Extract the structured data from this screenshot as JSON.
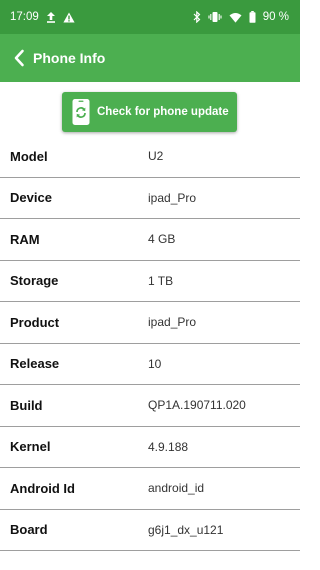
{
  "status_bar": {
    "time": "17:09",
    "battery": "90 %",
    "icons_left": [
      "upload-icon",
      "warning-icon"
    ],
    "icons_right": [
      "bluetooth-icon",
      "vibrate-icon",
      "wifi-icon",
      "battery-icon"
    ]
  },
  "app_bar": {
    "title": "Phone Info",
    "back_icon": "chevron-left-icon"
  },
  "update_button": {
    "label": "Check for phone update",
    "icon": "phone-update-icon"
  },
  "info": [
    {
      "label": "Model",
      "value": "U2"
    },
    {
      "label": "Device",
      "value": "ipad_Pro"
    },
    {
      "label": "RAM",
      "value": "4 GB"
    },
    {
      "label": "Storage",
      "value": "1 TB"
    },
    {
      "label": "Product",
      "value": "ipad_Pro"
    },
    {
      "label": "Release",
      "value": "10"
    },
    {
      "label": "Build",
      "value": "QP1A.190711.020"
    },
    {
      "label": "Kernel",
      "value": "4.9.188"
    },
    {
      "label": "Android Id",
      "value": "android_id"
    },
    {
      "label": "Board",
      "value": "g6j1_dx_u121"
    }
  ],
  "colors": {
    "status_bar": "#3a9a3e",
    "app_bar": "#4caf50",
    "divider": "#9e9e9e"
  }
}
